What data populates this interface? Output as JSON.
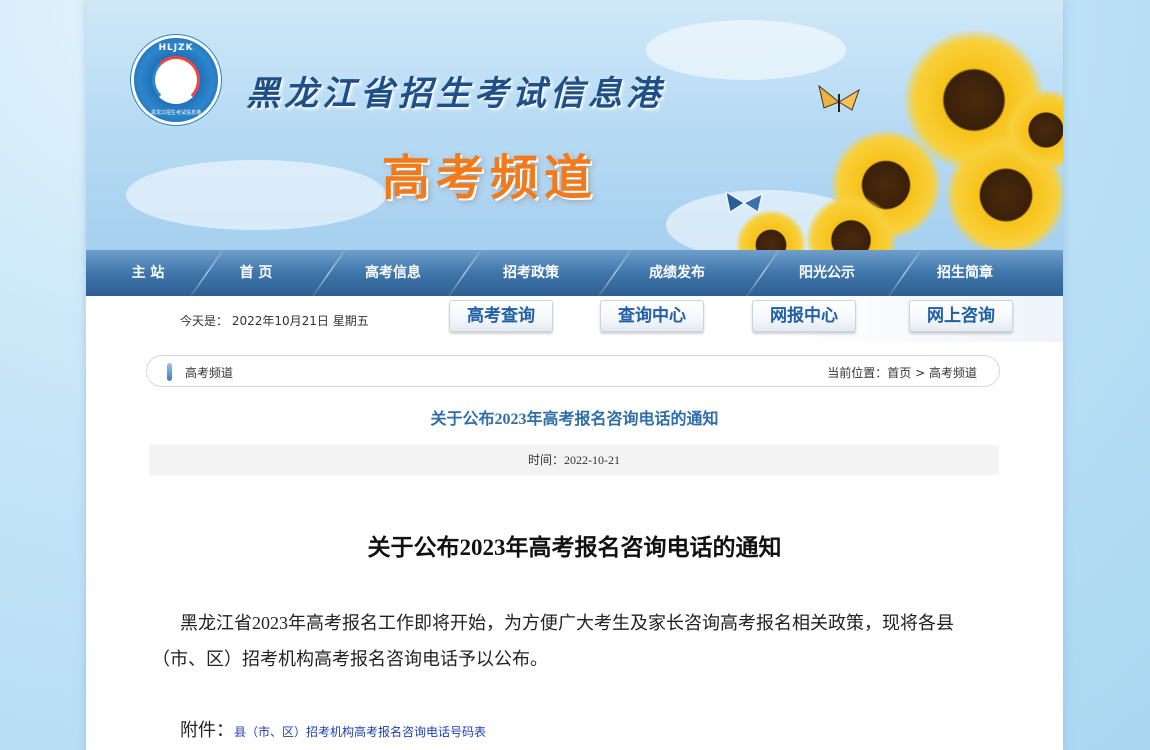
{
  "header": {
    "logo_text": "HLJZK",
    "logo_subtext": "黑龙江招生考试信息港",
    "site_name": "黑龙江省招生考试信息港",
    "channel_title": "高考频道"
  },
  "nav": {
    "items": [
      "主 站",
      "首 页",
      "高考信息",
      "招考政策",
      "成绩发布",
      "阳光公示",
      "招生简章"
    ]
  },
  "subbar": {
    "date_text": "今天是： 2022年10月21日 星期五",
    "buttons": [
      "高考查询",
      "查询中心",
      "网报中心",
      "网上咨询"
    ]
  },
  "breadcrumb": {
    "section": "高考频道",
    "location_label": "当前位置：",
    "home": "首页",
    "separator": " > ",
    "current": "高考频道"
  },
  "article": {
    "header_title": "关于公布2023年高考报名咨询电话的通知",
    "time_text": "时间：2022-10-21",
    "title": "关于公布2023年高考报名咨询电话的通知",
    "body": "黑龙江省2023年高考报名工作即将开始，为方便广大考生及家长咨询高考报名相关政策，现将各县（市、区）招考机构高考报名咨询电话予以公布。",
    "attachment_label": "附件：",
    "attachment_link": "县（市、区）招考机构高考报名咨询电话号码表"
  },
  "colors": {
    "nav_blue": "#3f76ab",
    "title_blue": "#2f6ea8",
    "channel_orange": "#f27a1b",
    "link_blue": "#1f3fb5"
  }
}
